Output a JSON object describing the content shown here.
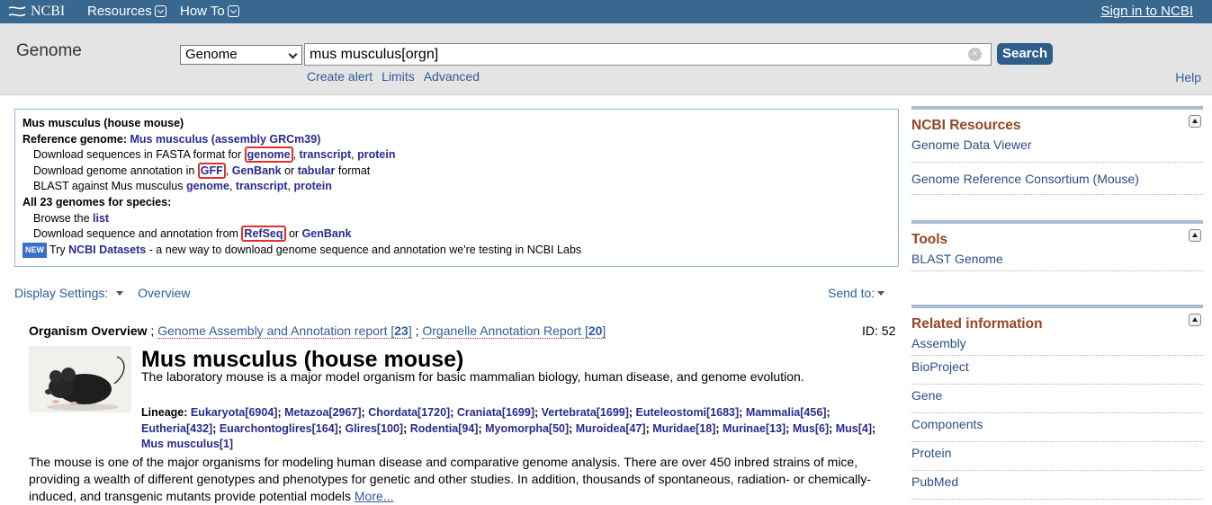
{
  "topbar": {
    "logo": "NCBI",
    "resources": "Resources",
    "howto": "How To",
    "signin": "Sign in to NCBI"
  },
  "search": {
    "db_title": "Genome",
    "db_selected": "Genome",
    "query": "mus musculus[orgn]",
    "button": "Search",
    "create_alert": "Create alert",
    "limits": "Limits",
    "advanced": "Advanced",
    "help": "Help"
  },
  "summary": {
    "organism": "Mus musculus (house mouse)",
    "ref_label": "Reference genome: ",
    "ref_link": "Mus musculus (assembly GRCm39)",
    "fasta_pre": "Download sequences in FASTA format for ",
    "fasta_genome": "genome",
    "fasta_comma": ", ",
    "fasta_transcript": "transcript",
    "fasta_protein": "protein",
    "annot_pre": "Download genome annotation in ",
    "annot_gff": "GFF",
    "annot_genbank": "GenBank",
    "annot_or": " or ",
    "annot_tabular": "tabular",
    "annot_post": " format",
    "blast_pre": "BLAST against Mus musculus ",
    "blast_genome": "genome",
    "blast_transcript": "transcript",
    "blast_protein": "protein",
    "all_genomes": "All 23 genomes for species:",
    "browse_pre": "Browse the ",
    "browse_list": "list",
    "dl_pre": "Download sequence and annotation from ",
    "dl_refseq": "RefSeq",
    "dl_or": " or ",
    "dl_genbank": "GenBank",
    "new_badge": "NEW",
    "datasets_pre": "Try ",
    "datasets_link": "NCBI Datasets",
    "datasets_post": " - a new way to download genome sequence and annotation we're testing in NCBI Labs"
  },
  "display": {
    "settings": "Display Settings:",
    "overview": "Overview",
    "send_to": "Send to:"
  },
  "overview": {
    "label": "Organism Overview",
    "sep1": " ; ",
    "assembly_report": "Genome Assembly and Annotation report [",
    "assembly_count": "23",
    "close1": "]",
    "sep2": " ; ",
    "organelle_report": "Organelle Annotation Report [",
    "organelle_count": "20",
    "close2": "]",
    "id": "ID: 52",
    "title": "Mus musculus (house mouse)",
    "tagline": "The laboratory mouse is a major model organism for basic mammalian biology, human disease, and genome evolution.",
    "lineage_label": "Lineage: ",
    "lineage": [
      "Eukaryota[6904]",
      "Metazoa[2967]",
      "Chordata[1720]",
      "Craniata[1699]",
      "Vertebrata[1699]",
      "Euteleostomi[1683]",
      "Mammalia[456]",
      "Eutheria[432]",
      "Euarchontoglires[164]",
      "Glires[100]",
      "Rodentia[94]",
      "Myomorpha[50]",
      "Muroidea[47]",
      "Muridae[18]",
      "Murinae[13]",
      "Mus[6]",
      "Mus[4]",
      "Mus musculus[1]"
    ],
    "description": "The mouse is one of the major organisms for modeling human disease and comparative genome analysis. There are over 450 inbred strains of mice, providing a wealth of different genotypes and phenotypes for genetic and other studies. In addition, thousands of spontaneous, radiation- or chemically-induced, and transgenic mutants provide potential models ",
    "more": "More..."
  },
  "sidebar": {
    "resources_title": "NCBI Resources",
    "resources": [
      "Genome Data Viewer",
      "Genome Reference Consortium (Mouse)"
    ],
    "tools_title": "Tools",
    "tools": [
      "BLAST Genome"
    ],
    "related_title": "Related information",
    "related": [
      "Assembly",
      "BioProject",
      "Gene",
      "Components",
      "Protein",
      "PubMed"
    ]
  }
}
